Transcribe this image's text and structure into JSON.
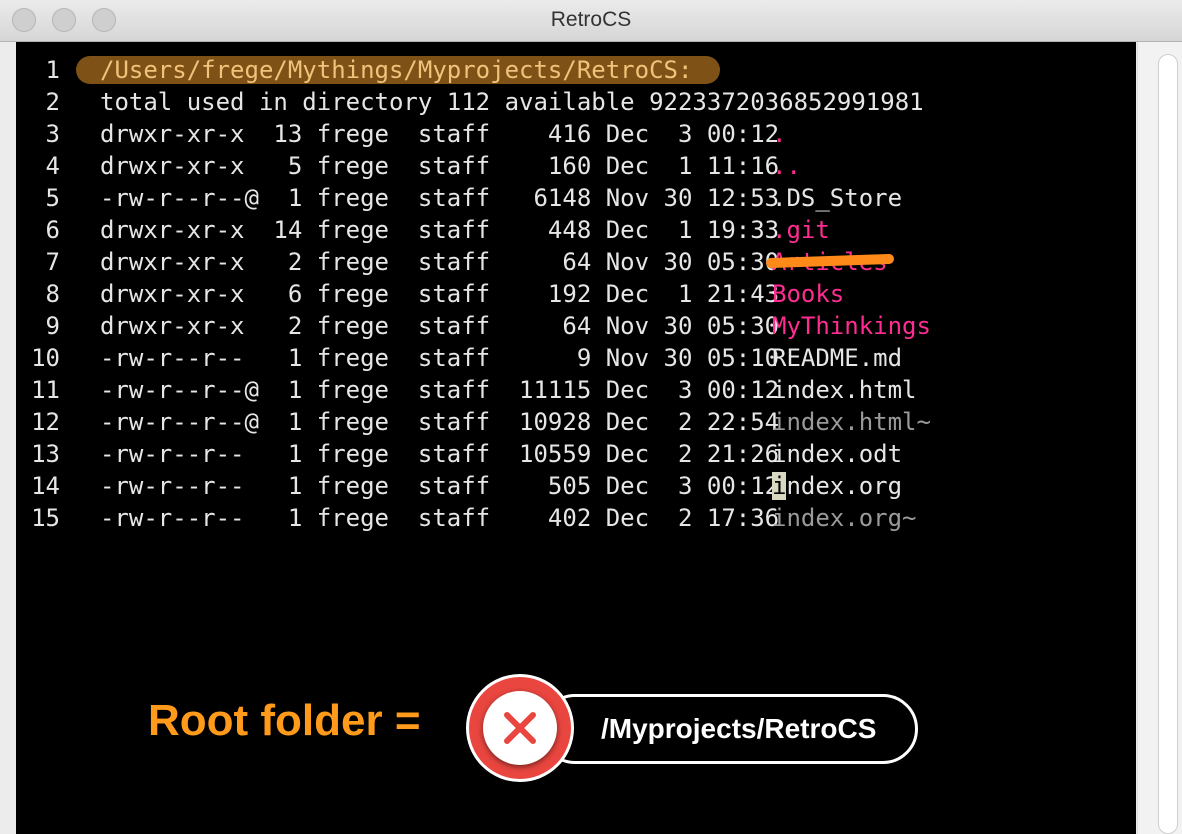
{
  "window": {
    "title": "RetroCS"
  },
  "listing": [
    {
      "num": "1",
      "text": "",
      "name": "/Users/frege/Mythings/Myprojects/RetroCS:",
      "color": "path"
    },
    {
      "num": "2",
      "text": "total used in directory 112 available 9223372036852991981",
      "name": "",
      "color": "white"
    },
    {
      "num": "3",
      "text": "drwxr-xr-x  13 frege  staff    416 Dec  3 00:12",
      "name": ".",
      "color": "pink"
    },
    {
      "num": "4",
      "text": "drwxr-xr-x   5 frege  staff    160 Dec  1 11:16",
      "name": "..",
      "color": "pink"
    },
    {
      "num": "5",
      "text": "-rw-r--r--@  1 frege  staff   6148 Nov 30 12:53",
      "name": ".DS_Store",
      "color": "white"
    },
    {
      "num": "6",
      "text": "drwxr-xr-x  14 frege  staff    448 Dec  1 19:33",
      "name": ".git",
      "color": "pink"
    },
    {
      "num": "7",
      "text": "drwxr-xr-x   2 frege  staff     64 Nov 30 05:30",
      "name": "Articles",
      "color": "pink"
    },
    {
      "num": "8",
      "text": "drwxr-xr-x   6 frege  staff    192 Dec  1 21:43",
      "name": "Books",
      "color": "pink"
    },
    {
      "num": "9",
      "text": "drwxr-xr-x   2 frege  staff     64 Nov 30 05:30",
      "name": "MyThinkings",
      "color": "pink"
    },
    {
      "num": "10",
      "text": "-rw-r--r--   1 frege  staff      9 Nov 30 05:10",
      "name": "README.md",
      "color": "white"
    },
    {
      "num": "11",
      "text": "-rw-r--r--@  1 frege  staff  11115 Dec  3 00:12",
      "name": "index.html",
      "color": "white"
    },
    {
      "num": "12",
      "text": "-rw-r--r--@  1 frege  staff  10928 Dec  2 22:54",
      "name": "index.html~",
      "color": "gray"
    },
    {
      "num": "13",
      "text": "-rw-r--r--   1 frege  staff  10559 Dec  2 21:26",
      "name": "index.odt",
      "color": "white"
    },
    {
      "num": "14",
      "text": "-rw-r--r--   1 frege  staff    505 Dec  3 00:12",
      "name": "index.org",
      "color": "white",
      "cursor": true
    },
    {
      "num": "15",
      "text": "-rw-r--r--   1 frege  staff    402 Dec  2 17:36",
      "name": "index.org~",
      "color": "gray"
    }
  ],
  "annotation": {
    "label": "Root folder =",
    "path": "/Myprojects/RetroCS",
    "icon": "x-icon",
    "accent": "#ff9a1a",
    "error_color": "#e9463f"
  },
  "colors": {
    "directory": "#ff2d91",
    "backup": "#9a9a9a",
    "text": "#e6e6e6",
    "background": "#000000"
  }
}
